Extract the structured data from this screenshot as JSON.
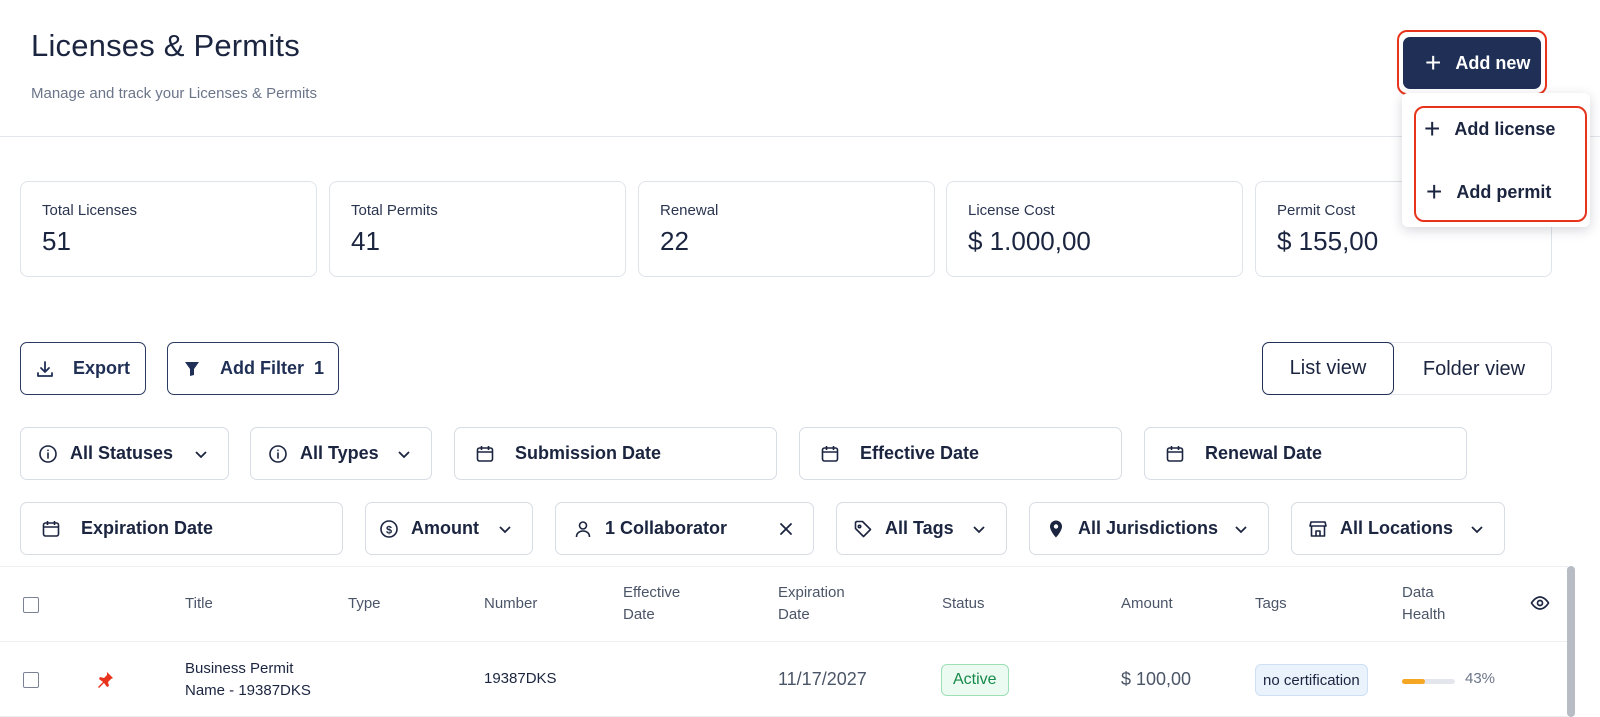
{
  "header": {
    "title": "Licenses & Permits",
    "subtitle": "Manage and track your Licenses & Permits",
    "add_new_label": "Add new"
  },
  "add_menu": {
    "items": [
      {
        "label": "Add license",
        "icon": "plus-icon"
      },
      {
        "label": "Add permit",
        "icon": "plus-icon"
      }
    ]
  },
  "stats": [
    {
      "label": "Total Licenses",
      "value": "51"
    },
    {
      "label": "Total Permits",
      "value": "41"
    },
    {
      "label": "Renewal",
      "value": "22"
    },
    {
      "label": "License Cost",
      "value": "$ 1.000,00"
    },
    {
      "label": "Permit Cost",
      "value": "$ 155,00"
    }
  ],
  "toolbar": {
    "export_label": "Export",
    "add_filter_label": "Add Filter",
    "filter_count": "1",
    "list_view_label": "List view",
    "folder_view_label": "Folder view",
    "active_view": "List view"
  },
  "filters": {
    "row1": [
      {
        "label": "All Statuses",
        "icon": "info-icon",
        "dropdown": true
      },
      {
        "label": "All Types",
        "icon": "info-icon",
        "dropdown": true
      },
      {
        "label": "Submission Date",
        "icon": "calendar-icon",
        "dropdown": false
      },
      {
        "label": "Effective Date",
        "icon": "calendar-icon",
        "dropdown": false
      },
      {
        "label": "Renewal Date",
        "icon": "calendar-icon",
        "dropdown": false
      }
    ],
    "row2": [
      {
        "label": "Expiration Date",
        "icon": "calendar-icon",
        "dropdown": false
      },
      {
        "label": "Amount",
        "icon": "dollar-circle-icon",
        "dropdown": true
      },
      {
        "label": "1 Collaborator",
        "icon": "user-icon",
        "dropdown": false,
        "clearable": true
      },
      {
        "label": "All Tags",
        "icon": "tag-icon",
        "dropdown": true
      },
      {
        "label": "All Jurisdictions",
        "icon": "location-pin-icon",
        "dropdown": true
      },
      {
        "label": "All Locations",
        "icon": "store-icon",
        "dropdown": true
      }
    ]
  },
  "table": {
    "columns": {
      "title": "Title",
      "type": "Type",
      "number": "Number",
      "effective_1": "Effective",
      "effective_2": "Date",
      "expiration_1": "Expiration",
      "expiration_2": "Date",
      "status": "Status",
      "amount": "Amount",
      "tags": "Tags",
      "health_1": "Data",
      "health_2": "Health"
    },
    "rows": [
      {
        "pinned": true,
        "title_line1": "Business Permit",
        "title_line2": "Name - 19387DKS",
        "type": "",
        "number": "19387DKS",
        "effective_date": "",
        "expiration_date": "11/17/2027",
        "status": "Active",
        "amount": "$ 100,00",
        "tag": "no certification",
        "data_health_percent": 43,
        "data_health_label": "43%"
      }
    ]
  },
  "colors": {
    "primary": "#1f2f55",
    "highlight": "#e8341c",
    "active_green": "#168a4a",
    "health_fill": "#f5a623",
    "pin_red": "#e8341c"
  }
}
